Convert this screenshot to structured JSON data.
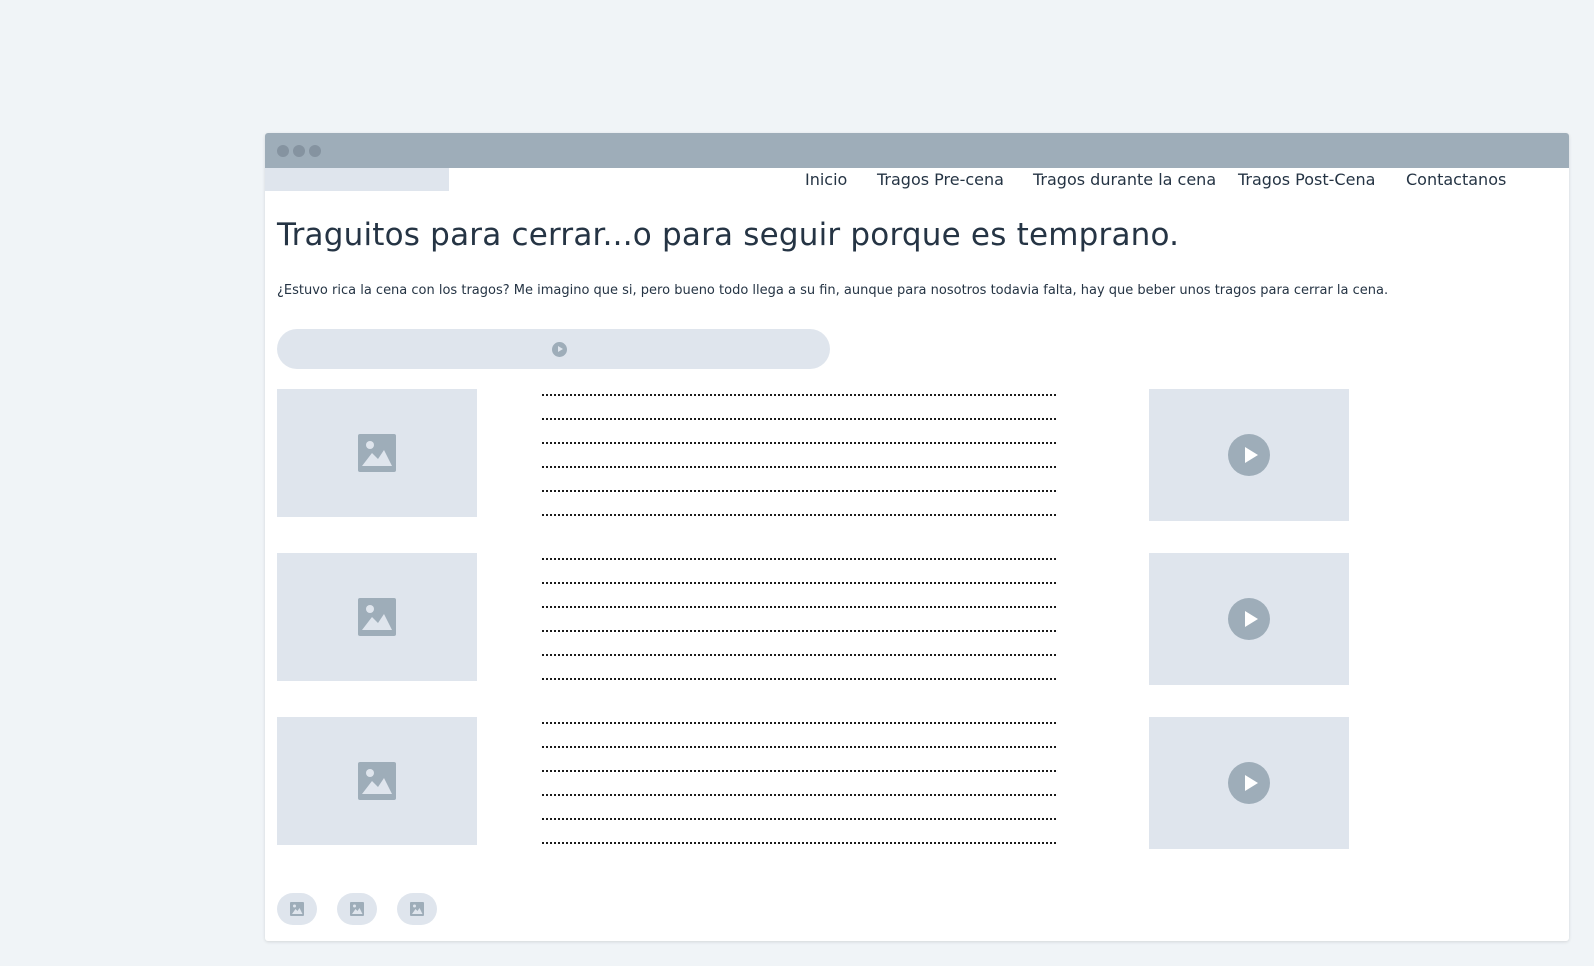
{
  "nav": {
    "items": [
      {
        "label": "Inicio"
      },
      {
        "label": "Tragos Pre-cena"
      },
      {
        "label": "Tragos durante la cena"
      },
      {
        "label": "Tragos Post-Cena"
      },
      {
        "label": "Contactanos"
      }
    ]
  },
  "main": {
    "headline": "Traguitos para cerrar...o para seguir porque es temprano.",
    "intro": "¿Estuvo rica la cena con los tragos? Me imagino que si, pero bueno todo llega a su fin, aunque para nosotros todavia falta, hay que beber unos tragos para cerrar la cena."
  },
  "colors": {
    "page_background": "#f0f4f7",
    "titlebar": "#9eadb9",
    "placeholder": "#dfe5ed",
    "icon": "#9eadb9",
    "text": "#253444"
  },
  "icons": {
    "image_placeholder": "image-icon",
    "video_placeholder": "play-icon",
    "audio": "play-icon",
    "footer": "image-icon"
  }
}
